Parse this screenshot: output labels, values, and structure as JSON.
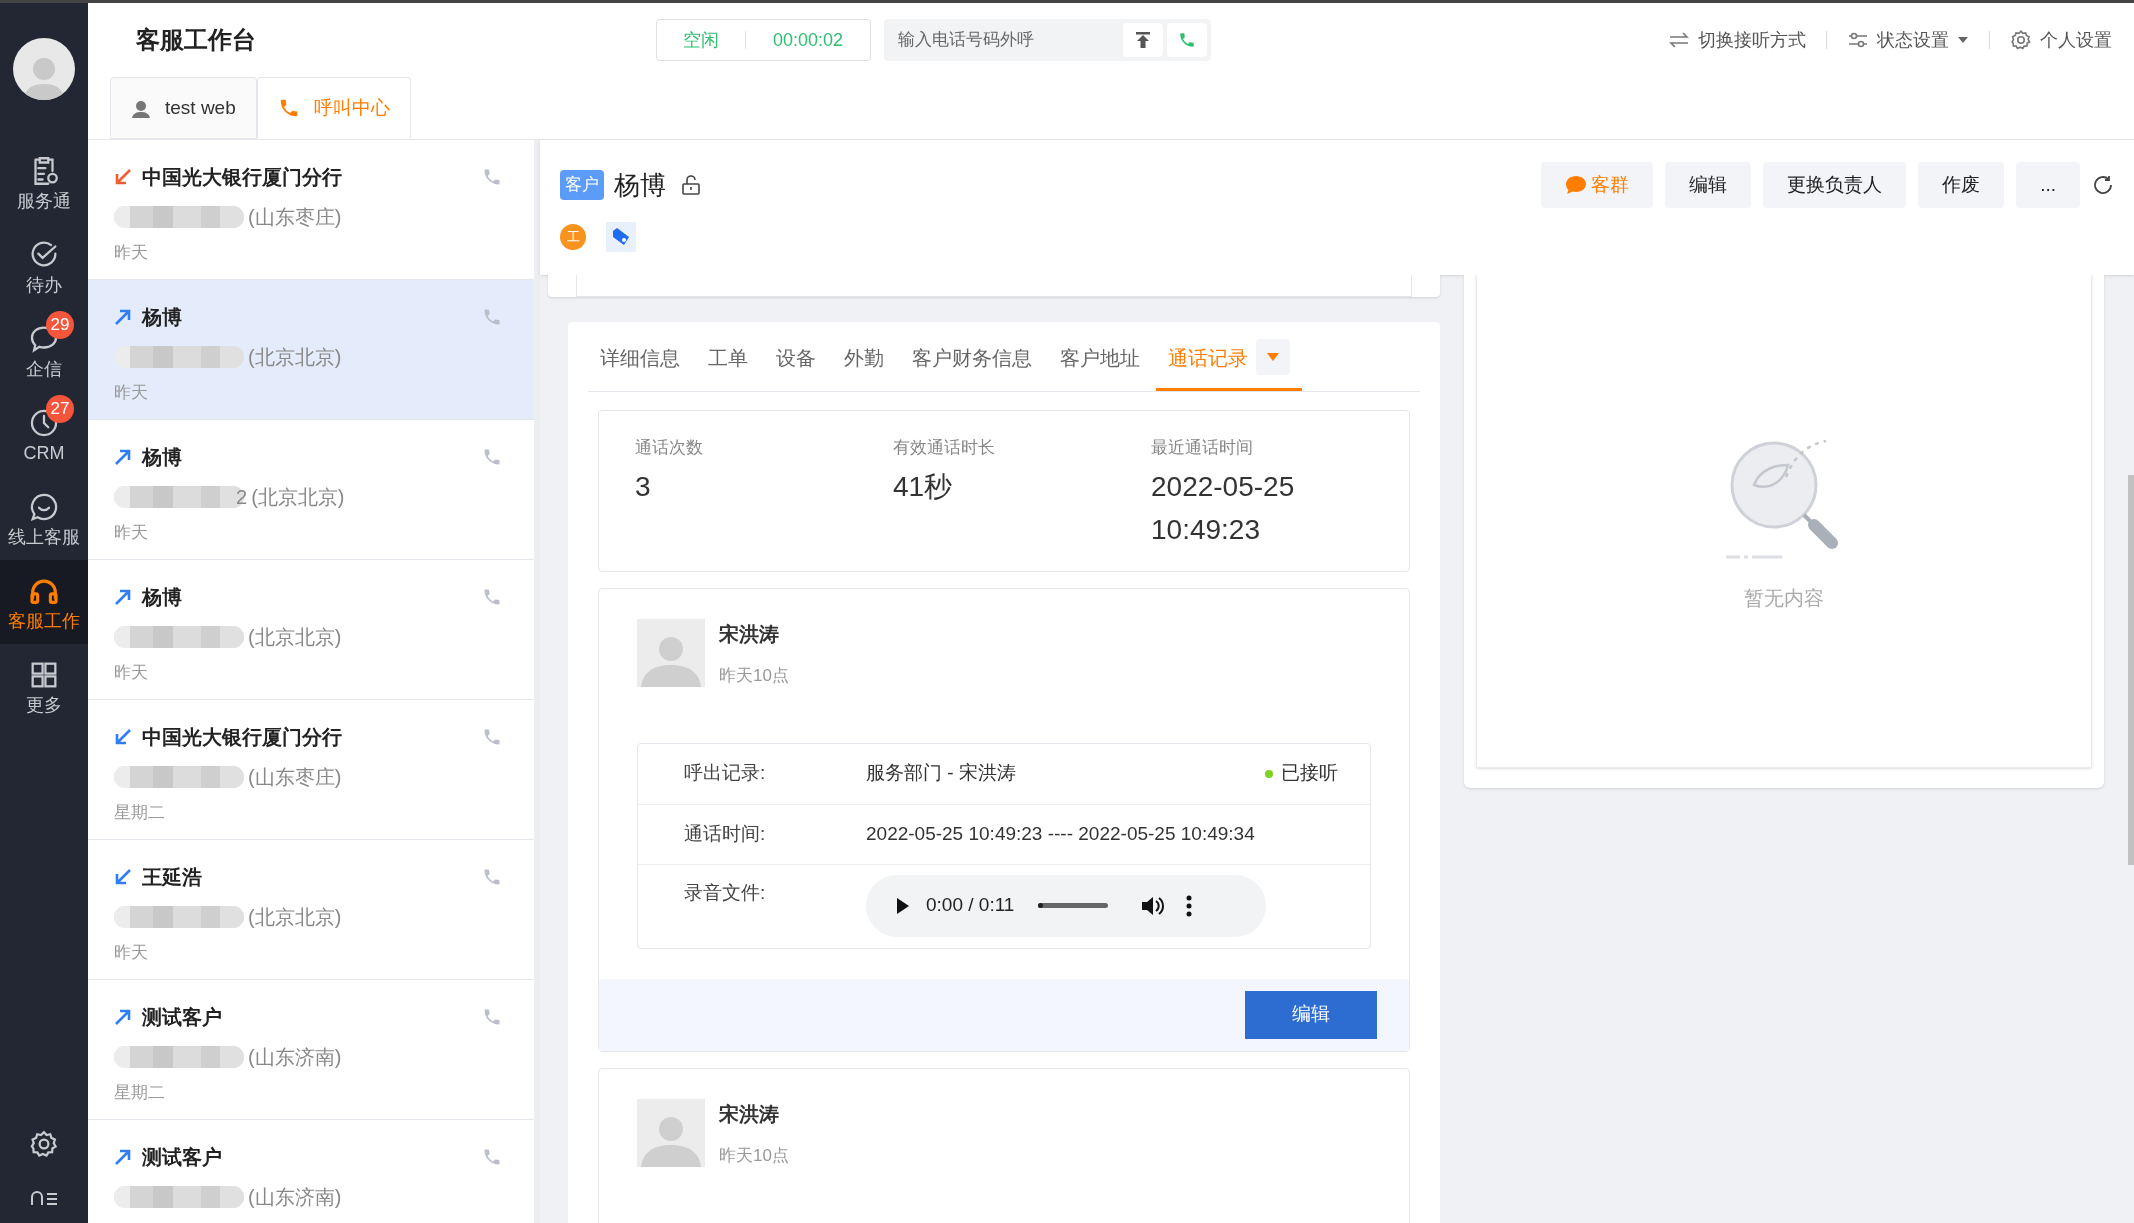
{
  "nav": {
    "items": [
      {
        "label": "服务通",
        "selected": false
      },
      {
        "label": "待办",
        "selected": false
      },
      {
        "label": "企信",
        "badge": "29",
        "selected": false
      },
      {
        "label": "CRM",
        "badge": "27",
        "selected": false
      },
      {
        "label": "线上客服",
        "selected": false
      },
      {
        "label": "客服工作",
        "selected": true
      },
      {
        "label": "更多",
        "selected": false
      }
    ]
  },
  "header": {
    "title": "客服工作台",
    "status": {
      "label": "空闲",
      "timer": "00:00:02"
    },
    "dial": {
      "placeholder": "输入电话号码外呼"
    },
    "actions": [
      {
        "label": "切换接听方式",
        "dropdown": false
      },
      {
        "label": "状态设置",
        "dropdown": true
      },
      {
        "label": "个人设置",
        "dropdown": false
      }
    ],
    "tabs": [
      {
        "label": "test web",
        "selected": false
      },
      {
        "label": "呼叫中心",
        "selected": true
      }
    ]
  },
  "calls": [
    {
      "kind": "incoming",
      "missed": true,
      "name": "中国光大银行厦门分行",
      "location": "(山东枣庄)",
      "date": "昨天",
      "selected": false
    },
    {
      "kind": "outgoing",
      "missed": false,
      "name": "杨博",
      "location": "(北京北京)",
      "date": "昨天",
      "selected": true
    },
    {
      "kind": "outgoing",
      "missed": false,
      "name": "杨博",
      "tail": "2",
      "location": "(北京北京)",
      "date": "昨天",
      "selected": false
    },
    {
      "kind": "outgoing",
      "missed": false,
      "name": "杨博",
      "location": "(北京北京)",
      "date": "昨天",
      "selected": false
    },
    {
      "kind": "incoming",
      "missed": false,
      "name": "中国光大银行厦门分行",
      "location": "(山东枣庄)",
      "date": "星期二",
      "selected": false
    },
    {
      "kind": "incoming",
      "missed": false,
      "name": "王延浩",
      "location": "(北京北京)",
      "date": "昨天",
      "selected": false
    },
    {
      "kind": "outgoing",
      "missed": false,
      "name": "测试客户",
      "location": "(山东济南)",
      "date": "星期二",
      "selected": false
    },
    {
      "kind": "outgoing",
      "missed": false,
      "name": "测试客户",
      "location": "(山东济南)",
      "selected": false
    }
  ],
  "customer": {
    "badge": "客户",
    "name": "杨博",
    "tag_letter": "工",
    "buttons": [
      {
        "label": "客群",
        "kind": "group"
      },
      {
        "label": "编辑",
        "kind": "plain"
      },
      {
        "label": "更换负责人",
        "kind": "plain"
      },
      {
        "label": "作废",
        "kind": "plain"
      },
      {
        "label": "...",
        "kind": "plain"
      }
    ]
  },
  "detail_tabs": [
    {
      "label": "详细信息",
      "selected": false
    },
    {
      "label": "工单",
      "selected": false
    },
    {
      "label": "设备",
      "selected": false
    },
    {
      "label": "外勤",
      "selected": false
    },
    {
      "label": "客户财务信息",
      "selected": false
    },
    {
      "label": "客户地址",
      "selected": false
    },
    {
      "label": "通话记录",
      "selected": true
    }
  ],
  "stats": [
    {
      "label": "通话次数",
      "value": "3"
    },
    {
      "label": "有效通话时长",
      "value": "41秒"
    },
    {
      "label": "最近通话时间",
      "value": "2022-05-25 10:49:23"
    }
  ],
  "records": [
    {
      "agent": "宋洪涛",
      "time": "昨天10点",
      "rows": [
        {
          "kind": "text",
          "label": "呼出记录:",
          "value": "服务部门 - 宋洪涛",
          "status": "已接听",
          "answered": true
        },
        {
          "kind": "text",
          "label": "通话时间:",
          "value": "2022-05-25 10:49:23 ---- 2022-05-25 10:49:34"
        },
        {
          "kind": "audio",
          "label": "录音文件:",
          "value": "0:00 / 0:11",
          "level": 0
        }
      ],
      "button": "编辑"
    },
    {
      "agent": "宋洪涛",
      "time": "昨天10点"
    }
  ],
  "side_panel": {
    "empty_text": "暂无内容"
  }
}
